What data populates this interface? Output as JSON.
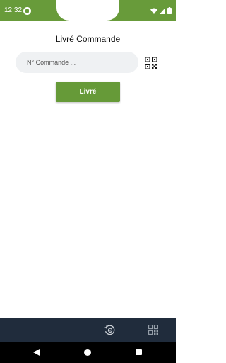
{
  "status_bar": {
    "time": "12:32",
    "background": "#689b3a",
    "icons": [
      "app-notification-icon",
      "wifi-icon",
      "signal-icon",
      "battery-icon"
    ]
  },
  "page": {
    "title": "Livré Commande"
  },
  "search": {
    "placeholder": "N° Commande ...",
    "value": ""
  },
  "actions": {
    "submit_label": "Livré",
    "submit_color": "#669a38",
    "scan_icon": "qr-code-icon"
  },
  "bottom_bar": {
    "background": "#202c3c",
    "icons": [
      "history-icon",
      "qr-grid-icon"
    ]
  },
  "system_nav": {
    "icons": [
      "back-icon",
      "home-icon",
      "recents-icon"
    ]
  }
}
